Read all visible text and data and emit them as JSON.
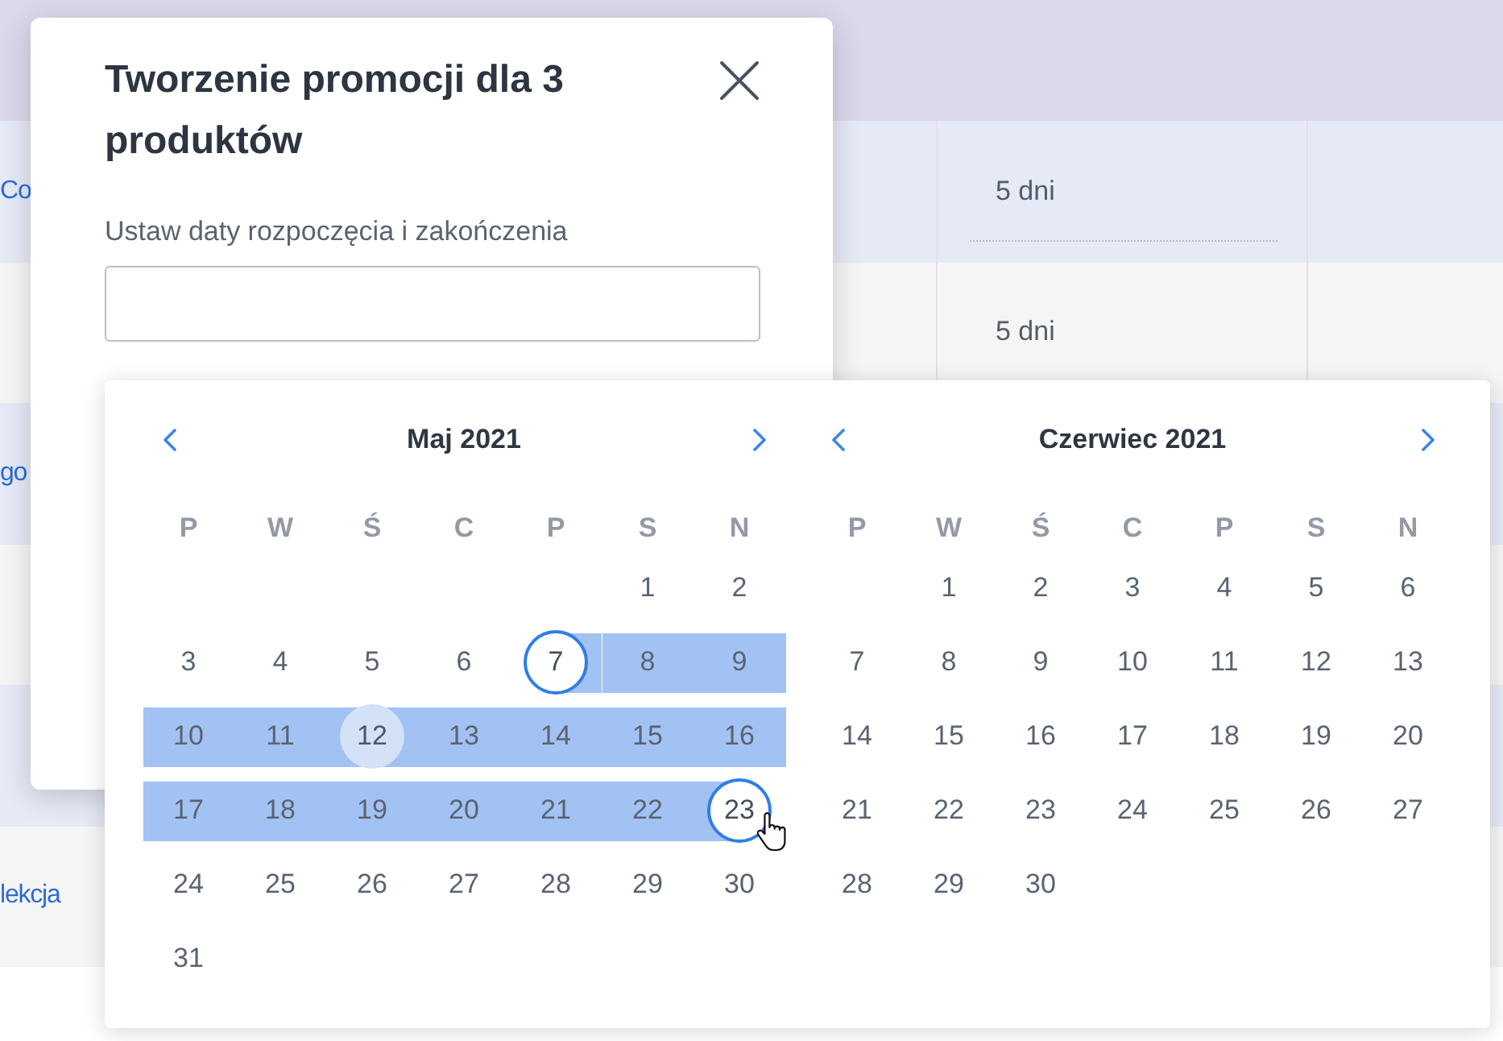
{
  "table": {
    "rows": [
      {
        "selected": true,
        "column_1": "Co",
        "column_2": "5 dni"
      },
      {
        "selected": false,
        "column_2": "5 dni"
      },
      {
        "selected": true,
        "column_1": "go"
      },
      {
        "selected": false
      },
      {
        "selected": true
      },
      {
        "selected": false,
        "column_1": "lekcja"
      }
    ]
  },
  "dialog": {
    "title": "Tworzenie promocji dla 3 produktów",
    "date_range_label": "Ustaw daty rozpoczęcia i zakończenia"
  },
  "date_picker": {
    "months": [
      {
        "title": "Maj 2021",
        "weekdays": [
          "P",
          "W",
          "Ś",
          "C",
          "P",
          "S",
          "N"
        ],
        "weeks": [
          {
            "align_end": true,
            "days": [
              {
                "day": "1",
                "selected": false,
                "in_range": false,
                "today": false
              },
              {
                "day": "2",
                "selected": false,
                "in_range": false,
                "today": false
              }
            ]
          },
          {
            "days": [
              {
                "day": "3",
                "selected": false,
                "in_range": false,
                "today": false
              },
              {
                "day": "4",
                "selected": false,
                "in_range": false,
                "today": false
              },
              {
                "day": "5",
                "selected": false,
                "in_range": false,
                "today": false
              },
              {
                "day": "6",
                "selected": false,
                "in_range": false,
                "today": false
              },
              {
                "day": "7",
                "selected": true,
                "in_range": true,
                "today": false
              },
              {
                "day": "8",
                "selected": false,
                "in_range": true,
                "today": false
              },
              {
                "day": "9",
                "selected": false,
                "in_range": true,
                "today": false
              }
            ]
          },
          {
            "days": [
              {
                "day": "10",
                "selected": false,
                "in_range": true,
                "today": false
              },
              {
                "day": "11",
                "selected": false,
                "in_range": true,
                "today": false
              },
              {
                "day": "12",
                "selected": false,
                "in_range": true,
                "today": true
              },
              {
                "day": "13",
                "selected": false,
                "in_range": true,
                "today": false
              },
              {
                "day": "14",
                "selected": false,
                "in_range": true,
                "today": false
              },
              {
                "day": "15",
                "selected": false,
                "in_range": true,
                "today": false
              },
              {
                "day": "16",
                "selected": false,
                "in_range": true,
                "today": false
              }
            ]
          },
          {
            "days": [
              {
                "day": "17",
                "selected": false,
                "in_range": true,
                "today": false
              },
              {
                "day": "18",
                "selected": false,
                "in_range": true,
                "today": false
              },
              {
                "day": "19",
                "selected": false,
                "in_range": true,
                "today": false
              },
              {
                "day": "20",
                "selected": false,
                "in_range": true,
                "today": false
              },
              {
                "day": "21",
                "selected": false,
                "in_range": true,
                "today": false
              },
              {
                "day": "22",
                "selected": false,
                "in_range": true,
                "today": false
              },
              {
                "day": "23",
                "selected": true,
                "in_range": true,
                "today": false
              }
            ]
          },
          {
            "days": [
              {
                "day": "24",
                "selected": false,
                "in_range": false,
                "today": false
              },
              {
                "day": "25",
                "selected": false,
                "in_range": false,
                "today": false
              },
              {
                "day": "26",
                "selected": false,
                "in_range": false,
                "today": false
              },
              {
                "day": "27",
                "selected": false,
                "in_range": false,
                "today": false
              },
              {
                "day": "28",
                "selected": false,
                "in_range": false,
                "today": false
              },
              {
                "day": "29",
                "selected": false,
                "in_range": false,
                "today": false
              },
              {
                "day": "30",
                "selected": false,
                "in_range": false,
                "today": false
              }
            ]
          },
          {
            "align_end": false,
            "days": [
              {
                "day": "31",
                "selected": false,
                "in_range": false,
                "today": false
              }
            ]
          }
        ]
      },
      {
        "title": "Czerwiec 2021",
        "weekdays": [
          "P",
          "W",
          "Ś",
          "C",
          "P",
          "S",
          "N"
        ],
        "weeks": [
          {
            "align_end": true,
            "days": [
              {
                "day": "1",
                "selected": false,
                "in_range": false,
                "today": false
              },
              {
                "day": "2",
                "selected": false,
                "in_range": false,
                "today": false
              },
              {
                "day": "3",
                "selected": false,
                "in_range": false,
                "today": false
              },
              {
                "day": "4",
                "selected": false,
                "in_range": false,
                "today": false
              },
              {
                "day": "5",
                "selected": false,
                "in_range": false,
                "today": false
              },
              {
                "day": "6",
                "selected": false,
                "in_range": false,
                "today": false
              }
            ]
          },
          {
            "days": [
              {
                "day": "7",
                "selected": false,
                "in_range": false,
                "today": false
              },
              {
                "day": "8",
                "selected": false,
                "in_range": false,
                "today": false
              },
              {
                "day": "9",
                "selected": false,
                "in_range": false,
                "today": false
              },
              {
                "day": "10",
                "selected": false,
                "in_range": false,
                "today": false
              },
              {
                "day": "11",
                "selected": false,
                "in_range": false,
                "today": false
              },
              {
                "day": "12",
                "selected": false,
                "in_range": false,
                "today": false
              },
              {
                "day": "13",
                "selected": false,
                "in_range": false,
                "today": false
              }
            ]
          },
          {
            "days": [
              {
                "day": "14",
                "selected": false,
                "in_range": false,
                "today": false
              },
              {
                "day": "15",
                "selected": false,
                "in_range": false,
                "today": false
              },
              {
                "day": "16",
                "selected": false,
                "in_range": false,
                "today": false
              },
              {
                "day": "17",
                "selected": false,
                "in_range": false,
                "today": false
              },
              {
                "day": "18",
                "selected": false,
                "in_range": false,
                "today": false
              },
              {
                "day": "19",
                "selected": false,
                "in_range": false,
                "today": false
              },
              {
                "day": "20",
                "selected": false,
                "in_range": false,
                "today": false
              }
            ]
          },
          {
            "days": [
              {
                "day": "21",
                "selected": false,
                "in_range": false,
                "today": false
              },
              {
                "day": "22",
                "selected": false,
                "in_range": false,
                "today": false
              },
              {
                "day": "23",
                "selected": false,
                "in_range": false,
                "today": false
              },
              {
                "day": "24",
                "selected": false,
                "in_range": false,
                "today": false
              },
              {
                "day": "25",
                "selected": false,
                "in_range": false,
                "today": false
              },
              {
                "day": "26",
                "selected": false,
                "in_range": false,
                "today": false
              },
              {
                "day": "27",
                "selected": false,
                "in_range": false,
                "today": false
              }
            ]
          },
          {
            "align_end": false,
            "days": [
              {
                "day": "28",
                "selected": false,
                "in_range": false,
                "today": false
              },
              {
                "day": "29",
                "selected": false,
                "in_range": false,
                "today": false
              },
              {
                "day": "30",
                "selected": false,
                "in_range": false,
                "today": false
              }
            ]
          }
        ]
      }
    ]
  }
}
